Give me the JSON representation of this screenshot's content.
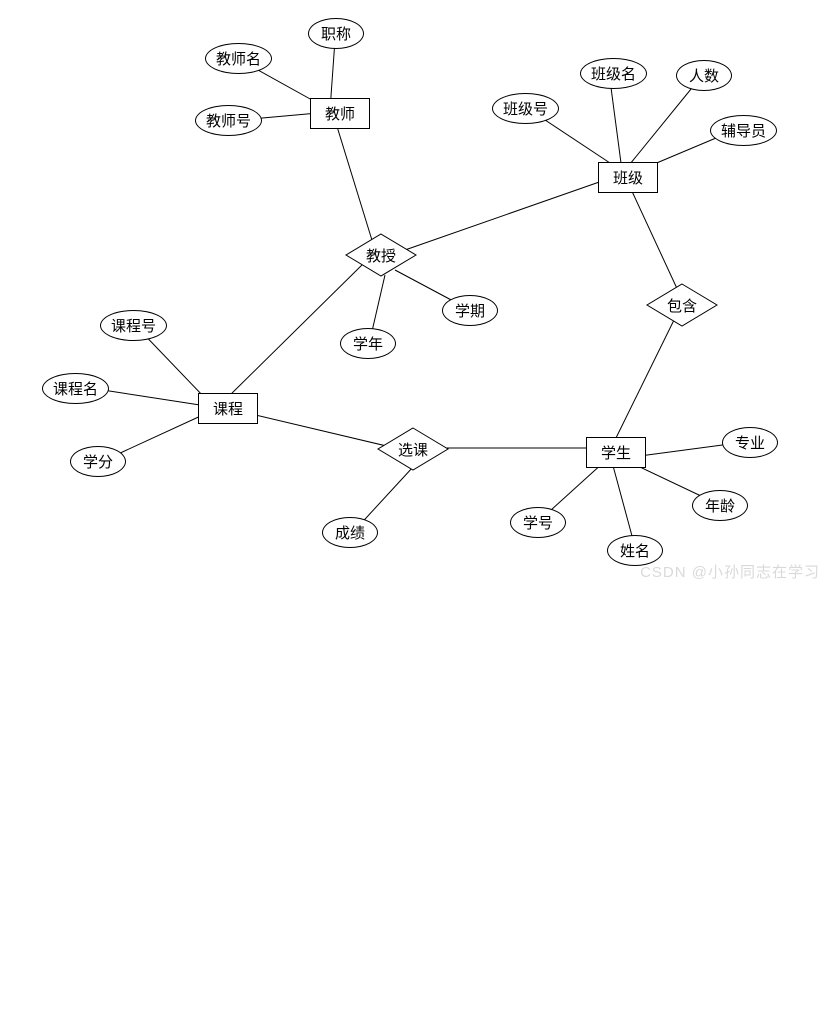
{
  "diagram": {
    "entities": {
      "teacher": "教师",
      "class": "班级",
      "course": "课程",
      "student": "学生"
    },
    "relationships": {
      "teaches": "教授",
      "contains": "包含",
      "enrolls": "选课"
    },
    "attributes": {
      "teacher_name": "教师名",
      "title": "职称",
      "teacher_id": "教师号",
      "class_id": "班级号",
      "class_name": "班级名",
      "headcount": "人数",
      "advisor": "辅导员",
      "semester": "学期",
      "year": "学年",
      "course_id": "课程号",
      "course_name": "课程名",
      "credit": "学分",
      "grade": "成绩",
      "student_id": "学号",
      "student_name": "姓名",
      "age": "年龄",
      "major": "专业"
    }
  },
  "watermark": "CSDN @小孙同志在学习"
}
